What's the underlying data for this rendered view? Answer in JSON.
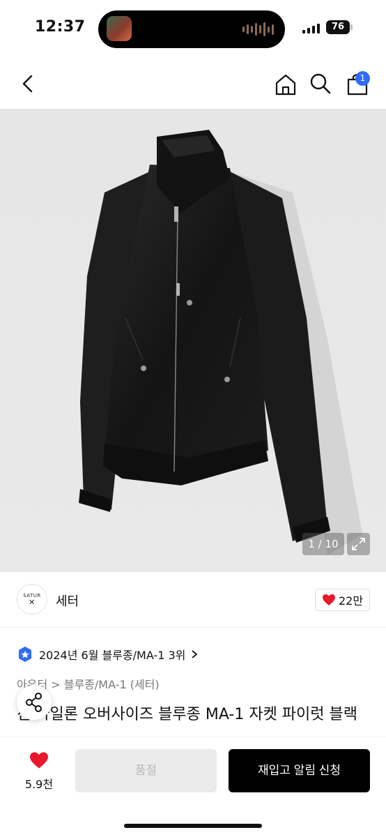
{
  "status_bar": {
    "time": "12:37",
    "battery": "76"
  },
  "nav": {
    "cart_count": "1"
  },
  "gallery": {
    "counter": "1 / 10"
  },
  "brand": {
    "logo_text": "SATUR",
    "name": "세터",
    "likes": "22만"
  },
  "ranking": {
    "text": "2024년 6월 블루종/MA-1 3위"
  },
  "category": {
    "text": "아우터 > 블루종/MA-1 (세터)"
  },
  "product": {
    "title": "진 나일론 오버사이즈 블루종 MA-1 자켓 파이럿 블랙"
  },
  "bottom_bar": {
    "wish_count": "5.9천",
    "soldout_label": "품절",
    "restock_label": "재입고 알림 신청"
  },
  "colors": {
    "accent_blue": "#2f6cf6",
    "heart_red": "#e8192c",
    "black": "#000000"
  }
}
